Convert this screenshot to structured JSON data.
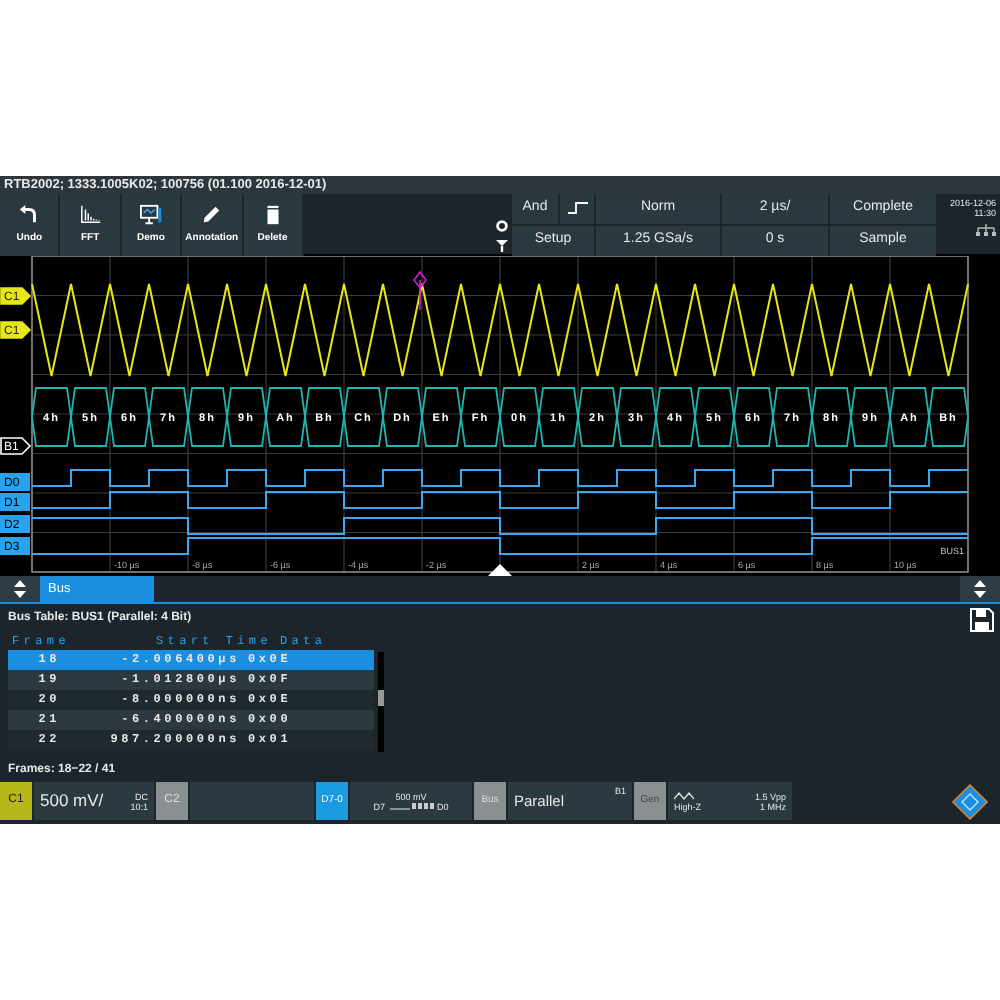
{
  "title_bar": {
    "text": "RTB2002; 1333.1005K02; 100756 (01.100 2016-12-01)"
  },
  "toolbar": [
    {
      "label": "Undo",
      "kind": "undo"
    },
    {
      "label": "FFT",
      "kind": "fft"
    },
    {
      "label": "Demo",
      "kind": "demo"
    },
    {
      "label": "Annotation",
      "kind": "annotation"
    },
    {
      "label": "Delete",
      "kind": "delete"
    }
  ],
  "acquisition": {
    "trigger_source": "And",
    "trigger_mode": "Norm",
    "timebase": "2 µs/",
    "state": "Complete",
    "setup": "Setup",
    "sample_rate": "1.25 GSa/s",
    "delay": "0 s",
    "mode": "Sample"
  },
  "clock": {
    "date": "2016-12-06",
    "time": "11:30"
  },
  "channel_labels": [
    {
      "text": "C1",
      "kind": "analog",
      "color": "#e6e619"
    },
    {
      "text": "C1",
      "kind": "analog",
      "color": "#e6e619"
    },
    {
      "text": "B1",
      "kind": "bus",
      "color": "#ffffff"
    },
    {
      "text": "D0",
      "kind": "digital",
      "color": "#29a3ef"
    },
    {
      "text": "D1",
      "kind": "digital",
      "color": "#29a3ef"
    },
    {
      "text": "D2",
      "kind": "digital",
      "color": "#29a3ef"
    },
    {
      "text": "D3",
      "kind": "digital",
      "color": "#29a3ef"
    }
  ],
  "bus_values": [
    "4h",
    "5h",
    "6h",
    "7h",
    "8h",
    "9h",
    "Ah",
    "Bh",
    "Ch",
    "Dh",
    "Eh",
    "Fh",
    "0h",
    "1h",
    "2h",
    "3h",
    "4h",
    "5h",
    "6h",
    "7h",
    "8h",
    "9h",
    "Ah",
    "Bh"
  ],
  "time_labels": [
    "-10 µs",
    "-8 µs",
    "-6 µs",
    "-4 µs",
    "-2 µs",
    "2 µs",
    "4 µs",
    "6 µs",
    "8 µs",
    "10 µs"
  ],
  "bus_name_label": "BUS1",
  "panel_tabs": [
    {
      "label": "Bus",
      "selected": true
    }
  ],
  "bus_table": {
    "title": "Bus Table: BUS1 (Parallel: 4 Bit)",
    "columns": [
      "Frame",
      "Start Time",
      "Data"
    ],
    "rows": [
      {
        "frame": "18",
        "start_time": "-2.006400µs",
        "data": "0x0E",
        "selected": true
      },
      {
        "frame": "19",
        "start_time": "-1.012800µs",
        "data": "0x0F",
        "selected": false
      },
      {
        "frame": "20",
        "start_time": "-8.000000ns",
        "data": "0x0E",
        "selected": false
      },
      {
        "frame": "21",
        "start_time": "-6.400000ns",
        "data": "0x00",
        "selected": false
      },
      {
        "frame": "22",
        "start_time": "987.200000ns",
        "data": "0x01",
        "selected": false
      }
    ],
    "footer": "Frames: 18−22 / 41"
  },
  "status_bar": {
    "c1": {
      "label": "C1",
      "scale": "500 mV/",
      "coupling": "DC",
      "probe": "10:1"
    },
    "c2": {
      "label": "C2"
    },
    "digital": {
      "label": "D7-0",
      "threshold": "500 mV",
      "msb": "D7",
      "lsb": "D0"
    },
    "bus": {
      "label": "Bus",
      "protocol": "Parallel",
      "bus_id": "B1"
    },
    "generator": {
      "label": "Gen",
      "impedance": "High-Z",
      "amplitude": "1.5 Vpp",
      "frequency": "1 MHz"
    }
  }
}
